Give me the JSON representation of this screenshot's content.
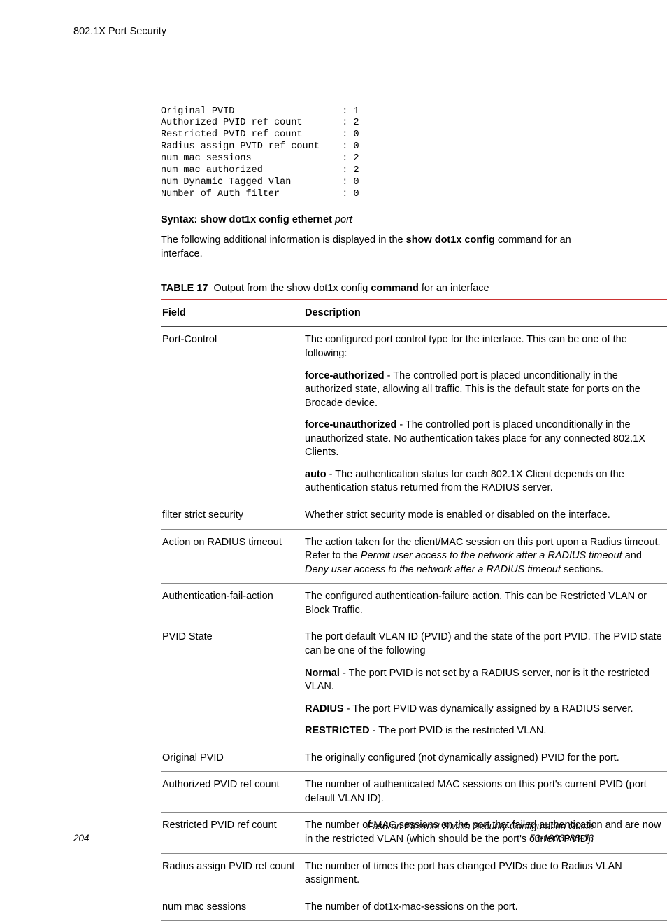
{
  "header": {
    "title": "802.1X Port Security"
  },
  "code_lines": [
    {
      "label": "Original PVID",
      "value": "1"
    },
    {
      "label": "Authorized PVID ref count",
      "value": "2"
    },
    {
      "label": "Restricted PVID ref count",
      "value": "0"
    },
    {
      "label": "Radius assign PVID ref count",
      "value": "0"
    },
    {
      "label": "num mac sessions",
      "value": "2"
    },
    {
      "label": "num mac authorized",
      "value": "2"
    },
    {
      "label": "num Dynamic Tagged Vlan",
      "value": "0"
    },
    {
      "label": "Number of Auth filter",
      "value": "0"
    }
  ],
  "syntax": {
    "label": "Syntax: show dot1x config ethernet",
    "arg": "port"
  },
  "follow": {
    "pre": "The following additional information is displayed in the ",
    "cmd": "show dot1x config",
    "post": " command for an interface."
  },
  "table_caption": {
    "num": "TABLE 17",
    "pre": "Output from the show dot1x config ",
    "bold": "command",
    "post": " for an interface"
  },
  "columns": {
    "c1": "Field",
    "c2": "Description"
  },
  "rows": [
    {
      "field": "Port-Control",
      "desc": [
        {
          "plain": "The configured port control type for the interface. This can be one of the following:"
        },
        {
          "bold": "force-authorized",
          "plain": " - The controlled port is placed unconditionally in the authorized state, allowing all traffic. This is the default state for ports on the Brocade device."
        },
        {
          "bold": "force-unauthorized",
          "plain": " - The controlled port is placed unconditionally in the unauthorized state. No authentication takes place for any connected 802.1X Clients."
        },
        {
          "bold": "auto",
          "plain": " - The authentication status for each 802.1X Client depends on the authentication status returned from the RADIUS server."
        }
      ]
    },
    {
      "field": "filter strict security",
      "desc": [
        {
          "plain": "Whether strict security mode is enabled or disabled on the interface."
        }
      ]
    },
    {
      "field": "Action on RADIUS timeout",
      "desc": [
        {
          "plain": "The action taken for the client/MAC session on this port upon a Radius timeout. Refer to the ",
          "ital": "Permit user access to the network after a RADIUS timeout",
          "plain2": " and ",
          "ital2": "Deny user access to the network after a RADIUS timeout",
          "plain3": " sections."
        }
      ]
    },
    {
      "field": "Authentication-fail-action",
      "desc": [
        {
          "plain": "The configured authentication-failure action. This can be Restricted VLAN or Block Traffic."
        }
      ]
    },
    {
      "field": "PVID State",
      "desc": [
        {
          "plain": "The port default VLAN ID (PVID) and the state of the port PVID. The PVID state can be one of the following"
        },
        {
          "bold": "Normal",
          "plain": " - The port PVID is not set by a RADIUS server, nor is it the restricted VLAN."
        },
        {
          "bold": "RADIUS",
          "plain": " - The port PVID was dynamically assigned by a RADIUS server."
        },
        {
          "bold": "RESTRICTED",
          "plain": " - The port PVID is the restricted VLAN."
        }
      ]
    },
    {
      "field": "Original PVID",
      "desc": [
        {
          "plain": "The originally configured (not dynamically assigned) PVID for the port."
        }
      ]
    },
    {
      "field": "Authorized PVID ref count",
      "desc": [
        {
          "plain": "The number of authenticated MAC sessions on this port's current PVID (port default VLAN ID)."
        }
      ]
    },
    {
      "field": "Restricted PVID ref count",
      "desc": [
        {
          "plain": "The number of MAC sessions on the port that failed authentication and are now in the restricted VLAN (which should be the port's current PVID)."
        }
      ]
    },
    {
      "field": "Radius assign PVID ref count",
      "desc": [
        {
          "plain": "The number of times the port has changed PVIDs due to Radius VLAN assignment."
        }
      ]
    },
    {
      "field": "num mac sessions",
      "desc": [
        {
          "plain": "The number of dot1x-mac-sessions on the port."
        }
      ]
    }
  ],
  "footer": {
    "page": "204",
    "title1": "FastIron Ethernet Switch Security Configuration Guide",
    "title2": "53-1003088-03"
  }
}
